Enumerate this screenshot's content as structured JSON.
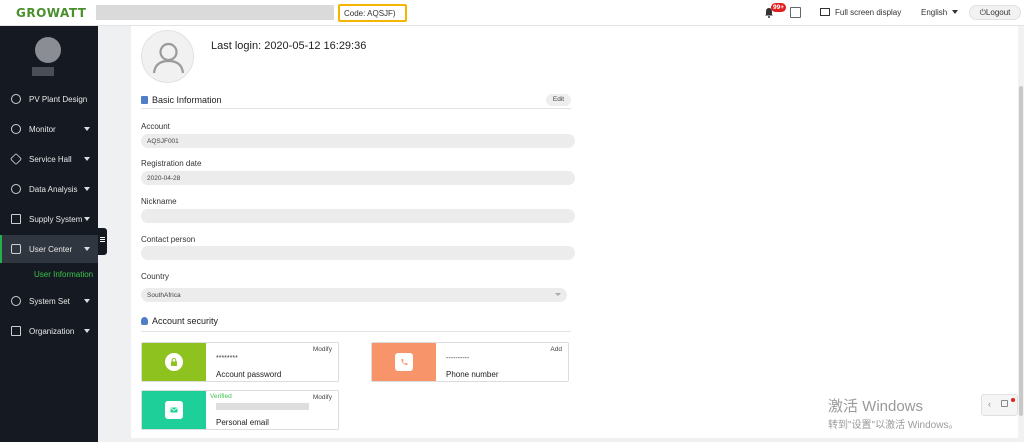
{
  "header": {
    "logo": "GROWATT",
    "code_label": "Code: AQSJF)",
    "notification_badge": "99+",
    "fullscreen_label": "Full screen display",
    "language": "English",
    "logout_label": "Logout"
  },
  "sidebar": {
    "items": [
      {
        "label": "PV Plant Design",
        "icon": "leaf-icon"
      },
      {
        "label": "Monitor",
        "icon": "monitor-icon"
      },
      {
        "label": "Service Hall",
        "icon": "diamond-icon"
      },
      {
        "label": "Data Analysis",
        "icon": "pie-chart-icon"
      },
      {
        "label": "Supply System",
        "icon": "supply-icon"
      },
      {
        "label": "User Center",
        "icon": "user-icon"
      },
      {
        "label": "System Set",
        "icon": "gear-icon"
      },
      {
        "label": "Organization",
        "icon": "org-icon"
      }
    ],
    "active_subitem": "User Information"
  },
  "profile": {
    "last_login": "Last login: 2020-05-12 16:29:36"
  },
  "basic_info": {
    "title": "Basic Information",
    "edit_label": "Edit",
    "fields": [
      {
        "label": "Account",
        "value": "AQSJF001"
      },
      {
        "label": "Registration date",
        "value": "2020-04-28"
      },
      {
        "label": "Nickname",
        "value": ""
      },
      {
        "label": "Contact person",
        "value": ""
      },
      {
        "label": "Country",
        "value": "SouthAfrica"
      }
    ]
  },
  "security": {
    "title": "Account security",
    "cards": [
      {
        "label": "Account password",
        "value": "********",
        "action": "Modify",
        "color": "#8dc21f",
        "icon": "lock-icon"
      },
      {
        "label": "Phone number",
        "value": "----------",
        "action": "Add",
        "color": "#f7946a",
        "icon": "phone-icon"
      },
      {
        "label": "Personal email",
        "value": "",
        "action": "Modify",
        "status": "Verified",
        "color": "#1fcf9a",
        "icon": "envelope-icon"
      }
    ]
  },
  "watermark": {
    "line1": "激活 Windows",
    "line2": "转到\"设置\"以激活 Windows。"
  }
}
